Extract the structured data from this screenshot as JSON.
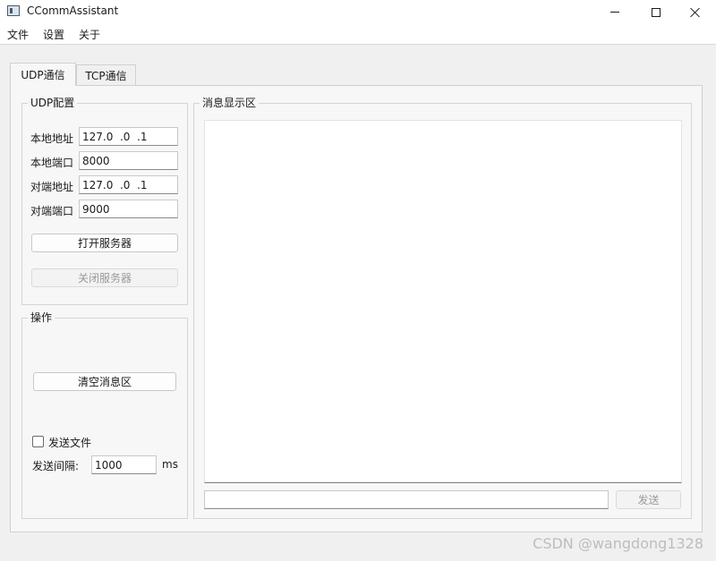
{
  "window": {
    "title": "CCommAssistant"
  },
  "menu": {
    "items": [
      "文件",
      "设置",
      "关于"
    ]
  },
  "tabs": [
    {
      "label": "UDP通信",
      "active": true
    },
    {
      "label": "TCP通信",
      "active": false
    }
  ],
  "udp_config": {
    "title": "UDP配置",
    "local_address": {
      "label": "本地地址",
      "value": "127.0  .0  .1"
    },
    "local_port": {
      "label": "本地端口",
      "value": "8000"
    },
    "remote_address": {
      "label": "对端地址",
      "value": "127.0  .0  .1"
    },
    "remote_port": {
      "label": "对端端口",
      "value": "9000"
    },
    "open_server_label": "打开服务器",
    "close_server_label": "关闭服务器"
  },
  "operations": {
    "title": "操作",
    "clear_label": "清空消息区",
    "send_file_label": "发送文件",
    "send_file_checked": false,
    "interval_label": "发送间隔:",
    "interval_value": "1000",
    "interval_unit": "ms"
  },
  "message_area": {
    "title": "消息显示区",
    "content": "",
    "input_value": "",
    "send_label": "发送"
  },
  "watermark": "CSDN @wangdong1328",
  "colors": {
    "window_bg": "#f0f0f0",
    "panel_bg": "#f7f7f7",
    "border": "#d0d0d0",
    "disabled_text": "#9a9a9a"
  }
}
